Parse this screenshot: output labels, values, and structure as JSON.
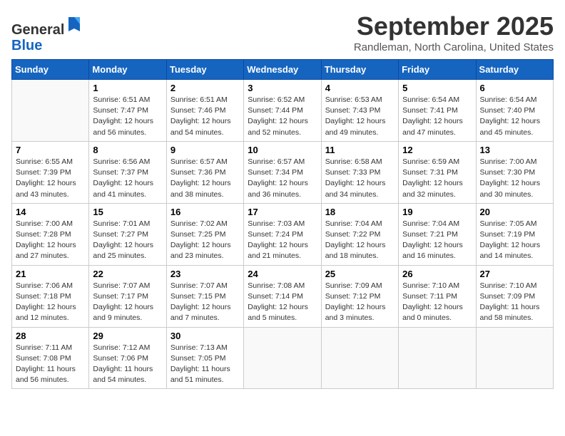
{
  "logo": {
    "general": "General",
    "blue": "Blue"
  },
  "title": "September 2025",
  "location": "Randleman, North Carolina, United States",
  "days_header": [
    "Sunday",
    "Monday",
    "Tuesday",
    "Wednesday",
    "Thursday",
    "Friday",
    "Saturday"
  ],
  "weeks": [
    [
      {
        "num": "",
        "info": ""
      },
      {
        "num": "1",
        "info": "Sunrise: 6:51 AM\nSunset: 7:47 PM\nDaylight: 12 hours\nand 56 minutes."
      },
      {
        "num": "2",
        "info": "Sunrise: 6:51 AM\nSunset: 7:46 PM\nDaylight: 12 hours\nand 54 minutes."
      },
      {
        "num": "3",
        "info": "Sunrise: 6:52 AM\nSunset: 7:44 PM\nDaylight: 12 hours\nand 52 minutes."
      },
      {
        "num": "4",
        "info": "Sunrise: 6:53 AM\nSunset: 7:43 PM\nDaylight: 12 hours\nand 49 minutes."
      },
      {
        "num": "5",
        "info": "Sunrise: 6:54 AM\nSunset: 7:41 PM\nDaylight: 12 hours\nand 47 minutes."
      },
      {
        "num": "6",
        "info": "Sunrise: 6:54 AM\nSunset: 7:40 PM\nDaylight: 12 hours\nand 45 minutes."
      }
    ],
    [
      {
        "num": "7",
        "info": "Sunrise: 6:55 AM\nSunset: 7:39 PM\nDaylight: 12 hours\nand 43 minutes."
      },
      {
        "num": "8",
        "info": "Sunrise: 6:56 AM\nSunset: 7:37 PM\nDaylight: 12 hours\nand 41 minutes."
      },
      {
        "num": "9",
        "info": "Sunrise: 6:57 AM\nSunset: 7:36 PM\nDaylight: 12 hours\nand 38 minutes."
      },
      {
        "num": "10",
        "info": "Sunrise: 6:57 AM\nSunset: 7:34 PM\nDaylight: 12 hours\nand 36 minutes."
      },
      {
        "num": "11",
        "info": "Sunrise: 6:58 AM\nSunset: 7:33 PM\nDaylight: 12 hours\nand 34 minutes."
      },
      {
        "num": "12",
        "info": "Sunrise: 6:59 AM\nSunset: 7:31 PM\nDaylight: 12 hours\nand 32 minutes."
      },
      {
        "num": "13",
        "info": "Sunrise: 7:00 AM\nSunset: 7:30 PM\nDaylight: 12 hours\nand 30 minutes."
      }
    ],
    [
      {
        "num": "14",
        "info": "Sunrise: 7:00 AM\nSunset: 7:28 PM\nDaylight: 12 hours\nand 27 minutes."
      },
      {
        "num": "15",
        "info": "Sunrise: 7:01 AM\nSunset: 7:27 PM\nDaylight: 12 hours\nand 25 minutes."
      },
      {
        "num": "16",
        "info": "Sunrise: 7:02 AM\nSunset: 7:25 PM\nDaylight: 12 hours\nand 23 minutes."
      },
      {
        "num": "17",
        "info": "Sunrise: 7:03 AM\nSunset: 7:24 PM\nDaylight: 12 hours\nand 21 minutes."
      },
      {
        "num": "18",
        "info": "Sunrise: 7:04 AM\nSunset: 7:22 PM\nDaylight: 12 hours\nand 18 minutes."
      },
      {
        "num": "19",
        "info": "Sunrise: 7:04 AM\nSunset: 7:21 PM\nDaylight: 12 hours\nand 16 minutes."
      },
      {
        "num": "20",
        "info": "Sunrise: 7:05 AM\nSunset: 7:19 PM\nDaylight: 12 hours\nand 14 minutes."
      }
    ],
    [
      {
        "num": "21",
        "info": "Sunrise: 7:06 AM\nSunset: 7:18 PM\nDaylight: 12 hours\nand 12 minutes."
      },
      {
        "num": "22",
        "info": "Sunrise: 7:07 AM\nSunset: 7:17 PM\nDaylight: 12 hours\nand 9 minutes."
      },
      {
        "num": "23",
        "info": "Sunrise: 7:07 AM\nSunset: 7:15 PM\nDaylight: 12 hours\nand 7 minutes."
      },
      {
        "num": "24",
        "info": "Sunrise: 7:08 AM\nSunset: 7:14 PM\nDaylight: 12 hours\nand 5 minutes."
      },
      {
        "num": "25",
        "info": "Sunrise: 7:09 AM\nSunset: 7:12 PM\nDaylight: 12 hours\nand 3 minutes."
      },
      {
        "num": "26",
        "info": "Sunrise: 7:10 AM\nSunset: 7:11 PM\nDaylight: 12 hours\nand 0 minutes."
      },
      {
        "num": "27",
        "info": "Sunrise: 7:10 AM\nSunset: 7:09 PM\nDaylight: 11 hours\nand 58 minutes."
      }
    ],
    [
      {
        "num": "28",
        "info": "Sunrise: 7:11 AM\nSunset: 7:08 PM\nDaylight: 11 hours\nand 56 minutes."
      },
      {
        "num": "29",
        "info": "Sunrise: 7:12 AM\nSunset: 7:06 PM\nDaylight: 11 hours\nand 54 minutes."
      },
      {
        "num": "30",
        "info": "Sunrise: 7:13 AM\nSunset: 7:05 PM\nDaylight: 11 hours\nand 51 minutes."
      },
      {
        "num": "",
        "info": ""
      },
      {
        "num": "",
        "info": ""
      },
      {
        "num": "",
        "info": ""
      },
      {
        "num": "",
        "info": ""
      }
    ]
  ]
}
